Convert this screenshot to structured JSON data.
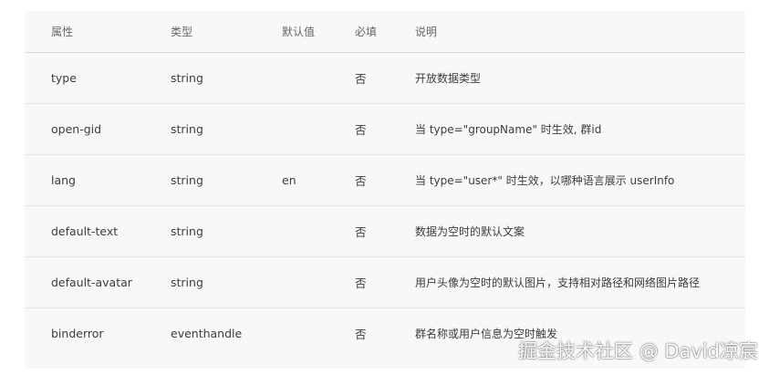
{
  "table": {
    "headers": [
      "属性",
      "类型",
      "默认值",
      "必填",
      "说明"
    ],
    "rows": [
      [
        "type",
        "string",
        "",
        "否",
        "开放数据类型"
      ],
      [
        "open-gid",
        "string",
        "",
        "否",
        "当 type=\"groupName\" 时生效, 群id"
      ],
      [
        "lang",
        "string",
        "en",
        "否",
        "当 type=\"user*\" 时生效，以哪种语言展示 userInfo"
      ],
      [
        "default-text",
        "string",
        "",
        "否",
        "数据为空时的默认文案"
      ],
      [
        "default-avatar",
        "string",
        "",
        "否",
        "用户头像为空时的默认图片，支持相对路径和网络图片路径"
      ],
      [
        "binderror",
        "eventhandle",
        "",
        "否",
        "群名称或用户信息为空时触发"
      ]
    ]
  },
  "watermark": "掘金技术社区 @ David凉宸"
}
